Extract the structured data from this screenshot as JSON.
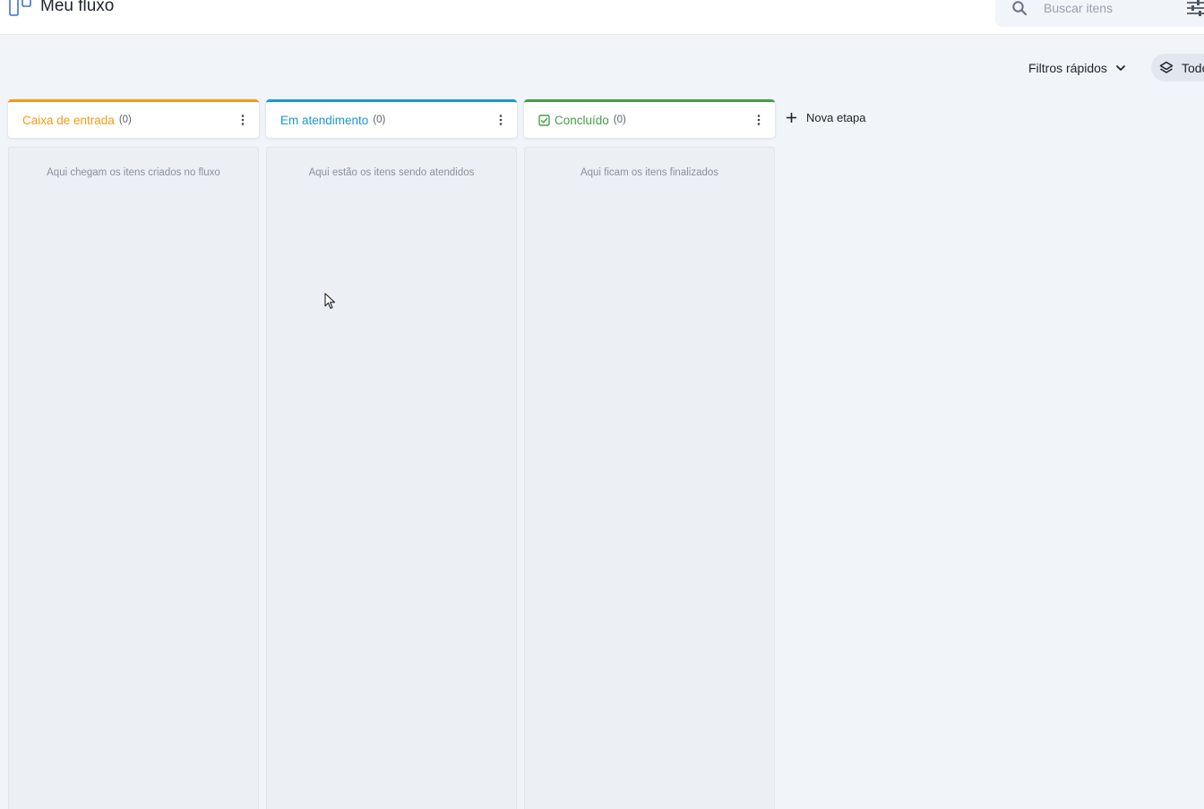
{
  "header": {
    "title": "Meu fluxo",
    "search_placeholder": "Buscar itens"
  },
  "toolbar": {
    "quick_filters_label": "Filtros rápidos",
    "view_label": "Todos"
  },
  "columns": [
    {
      "title": "Caixa de entrada",
      "count": "(0)",
      "empty_text": "Aqui chegam os itens criados no fluxo",
      "color": "#f39c12"
    },
    {
      "title": "Em atendimento",
      "count": "(0)",
      "empty_text": "Aqui estão os itens sendo atendidos",
      "color": "#1a98d5"
    },
    {
      "title": "Concluído",
      "count": "(0)",
      "empty_text": "Aqui ficam os itens finalizados",
      "color": "#43a047"
    }
  ],
  "new_stage_label": "Nova etapa",
  "icons": {
    "app": "kanban-board-icon",
    "search": "search-icon",
    "filter_settings": "sliders-icon",
    "chevron": "chevron-down-icon",
    "view": "layers-icon",
    "column_menu": "more-vertical-icon",
    "done": "check-box-icon",
    "add": "plus-icon"
  }
}
